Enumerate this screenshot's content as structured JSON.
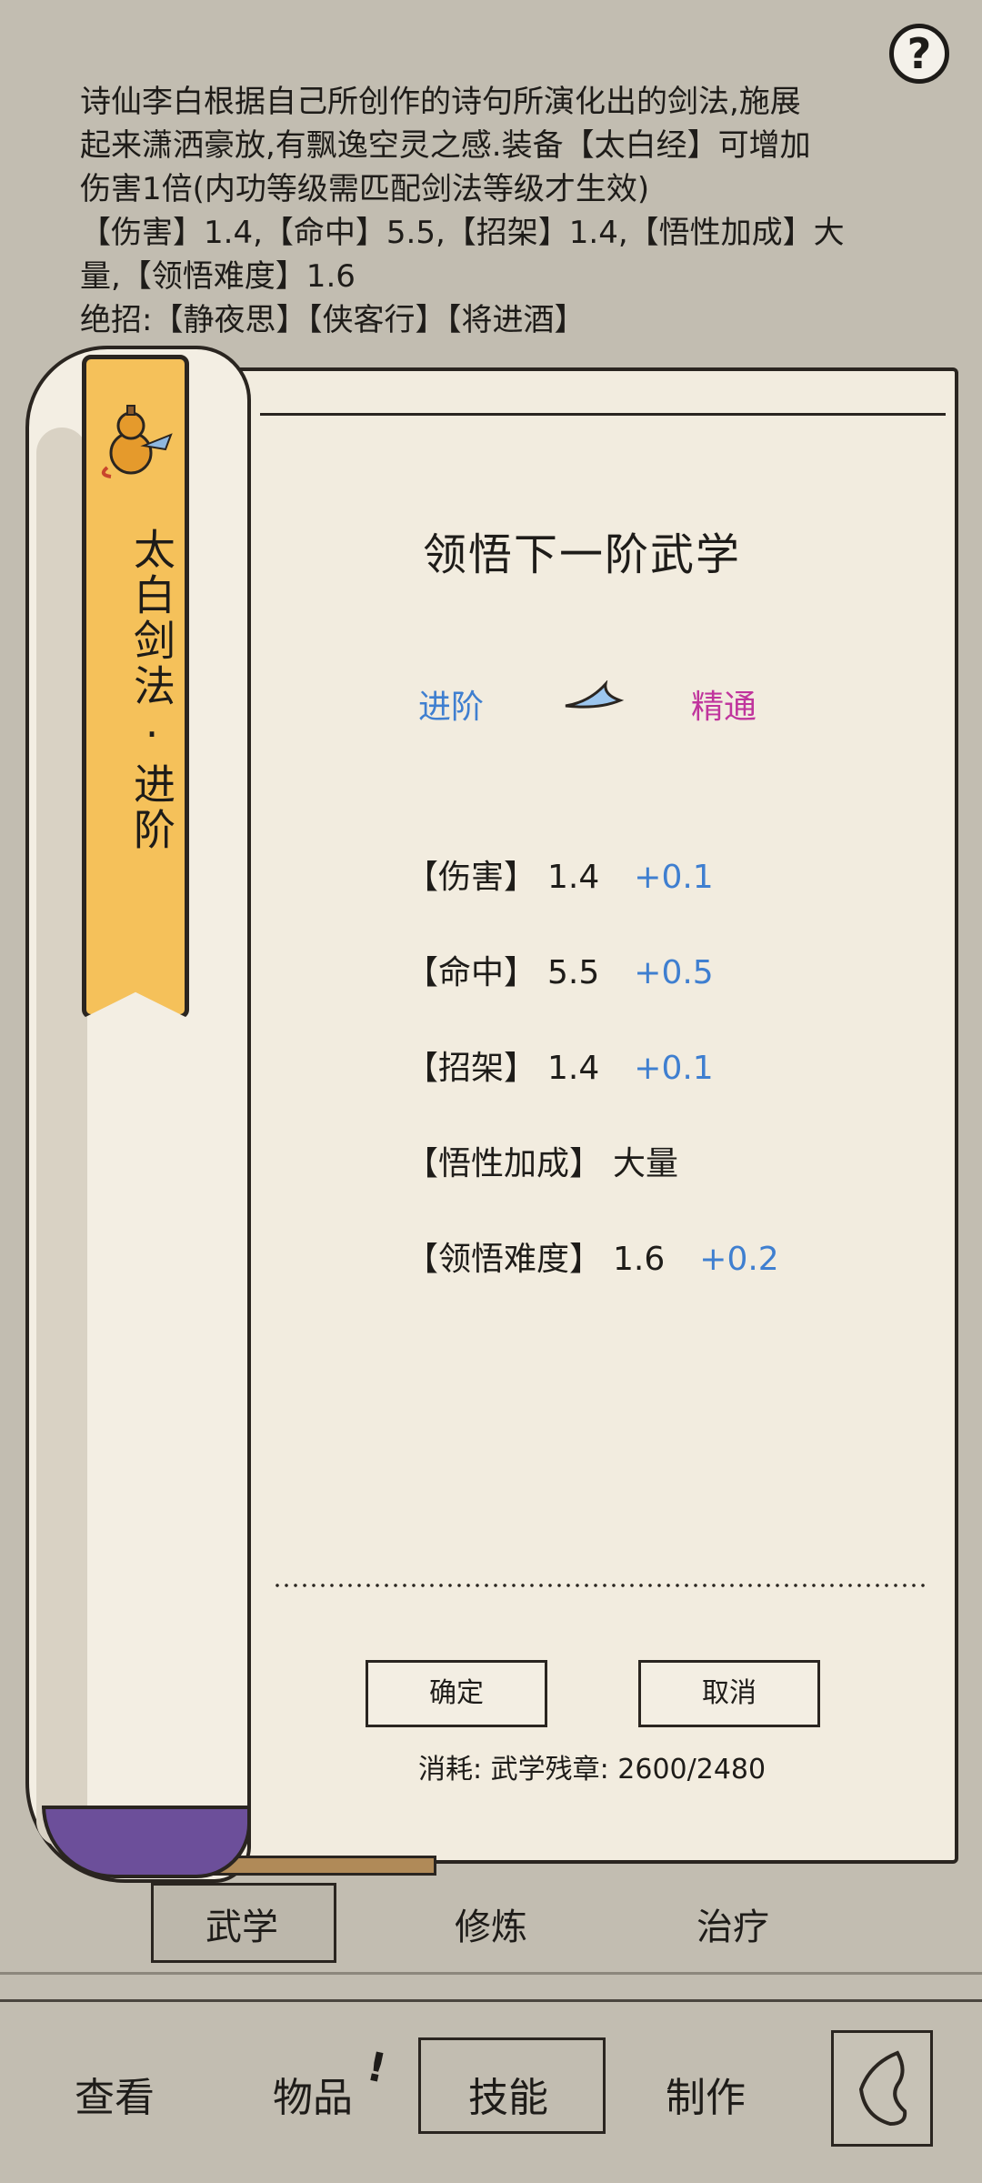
{
  "description": {
    "lines": [
      "诗仙李白根据自己所创作的诗句所演化出的剑法,施展",
      "起来潇洒豪放,有飘逸空灵之感.装备【太白经】可增加",
      "伤害1倍(内功等级需匹配剑法等级才生效)",
      "【伤害】1.4,【命中】5.5,【招架】1.4,【悟性加成】大",
      "量,【领悟难度】1.6",
      "绝招:【静夜思】【侠客行】【将进酒】"
    ]
  },
  "banner": {
    "title": "太白剑法·进阶"
  },
  "dialog": {
    "title": "领悟下一阶武学",
    "rank_from": "进阶",
    "rank_to": "精通",
    "stats": [
      {
        "name": "【伤害】",
        "value": "1.4",
        "increase": "+0.1"
      },
      {
        "name": "【命中】",
        "value": "5.5",
        "increase": "+0.5"
      },
      {
        "name": "【招架】",
        "value": "1.4",
        "increase": "+0.1"
      },
      {
        "name": "【悟性加成】",
        "value": "大量",
        "increase": ""
      },
      {
        "name": "【领悟难度】",
        "value": "1.6",
        "increase": "+0.2"
      }
    ],
    "confirm_label": "确定",
    "cancel_label": "取消",
    "cost_text": "消耗: 武学残章: 2600/2480"
  },
  "subtabs": [
    "武学",
    "修炼",
    "治疗"
  ],
  "nav": {
    "items": [
      "查看",
      "物品",
      "技能",
      "制作"
    ],
    "alert_mark": "!"
  },
  "help_label": "?",
  "colors": {
    "increase": "#3f7fd0",
    "rank_to": "#c0359d",
    "banner": "#f5c15a"
  }
}
